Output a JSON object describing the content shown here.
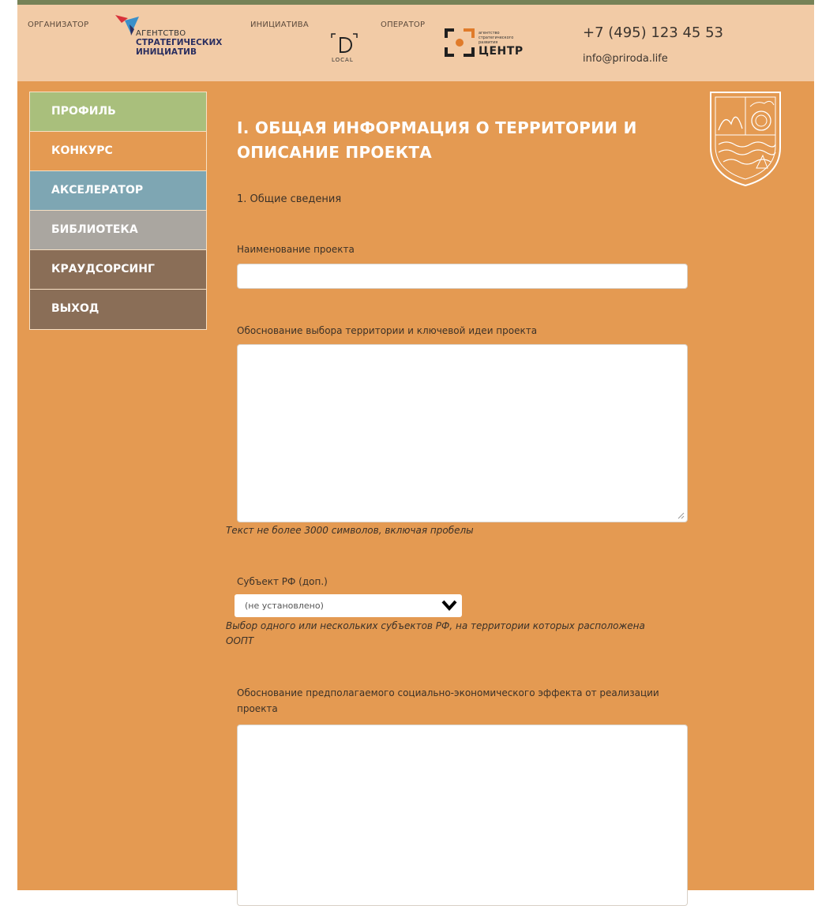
{
  "header": {
    "organizer_label": "ОРГАНИЗАТОР",
    "asi_line1": "АГЕНТСТВО",
    "asi_line2": "СТРАТЕГИЧЕСКИХ",
    "asi_line3": "ИНИЦИАТИВ",
    "initiative_label": "ИНИЦИАТИВА",
    "local_logo_text": "LOCAL",
    "operator_label": "ОПЕРАТОР",
    "center_small_text": "агентство стратегического развития",
    "center_big_text": "ЦЕНТР",
    "phone": "+7 (495) 123 45 53",
    "email": "info@priroda.life",
    "accent_color": "#768257",
    "background_color": "#f2cba6"
  },
  "sidebar": {
    "items": [
      {
        "label": "ПРОФИЛЬ",
        "color": "#a9bf7c"
      },
      {
        "label": "КОНКУРС",
        "color": "#e49a52"
      },
      {
        "label": "АКСЕЛЕРАТОР",
        "color": "#7ea6b3"
      },
      {
        "label": "БИБЛИОТЕКА",
        "color": "#aaa6a0"
      },
      {
        "label": "КРАУДСОРСИНГ",
        "color": "#8a6e57"
      },
      {
        "label": "ВЫХОД",
        "color": "#8a6e57"
      }
    ]
  },
  "main": {
    "title_line1": "I. ОБЩАЯ ИНФОРМАЦИЯ О ТЕРРИТОРИИ И",
    "title_line2": "ОПИСАНИЕ ПРОЕКТА",
    "section": "1. Общие сведения",
    "project_name_label": "Наименование проекта",
    "project_name_value": "",
    "justification_label": "Обоснование выбора территории и ключевой идеи проекта",
    "justification_value": "",
    "justification_hint": "Текст не более 3000 символов, включая пробелы",
    "subject_label": "Субъект РФ (доп.)",
    "subject_selected": "(не установлено)",
    "subject_hint_line1": "Выбор одного или нескольких субъектов РФ, на территории которых расположена",
    "subject_hint_line2": "ООПТ",
    "effect_label_line1": "Обоснование предполагаемого социально-экономического эффекта от реализации",
    "effect_label_line2": "проекта",
    "effect_value": "",
    "background_color": "#e49a52"
  }
}
